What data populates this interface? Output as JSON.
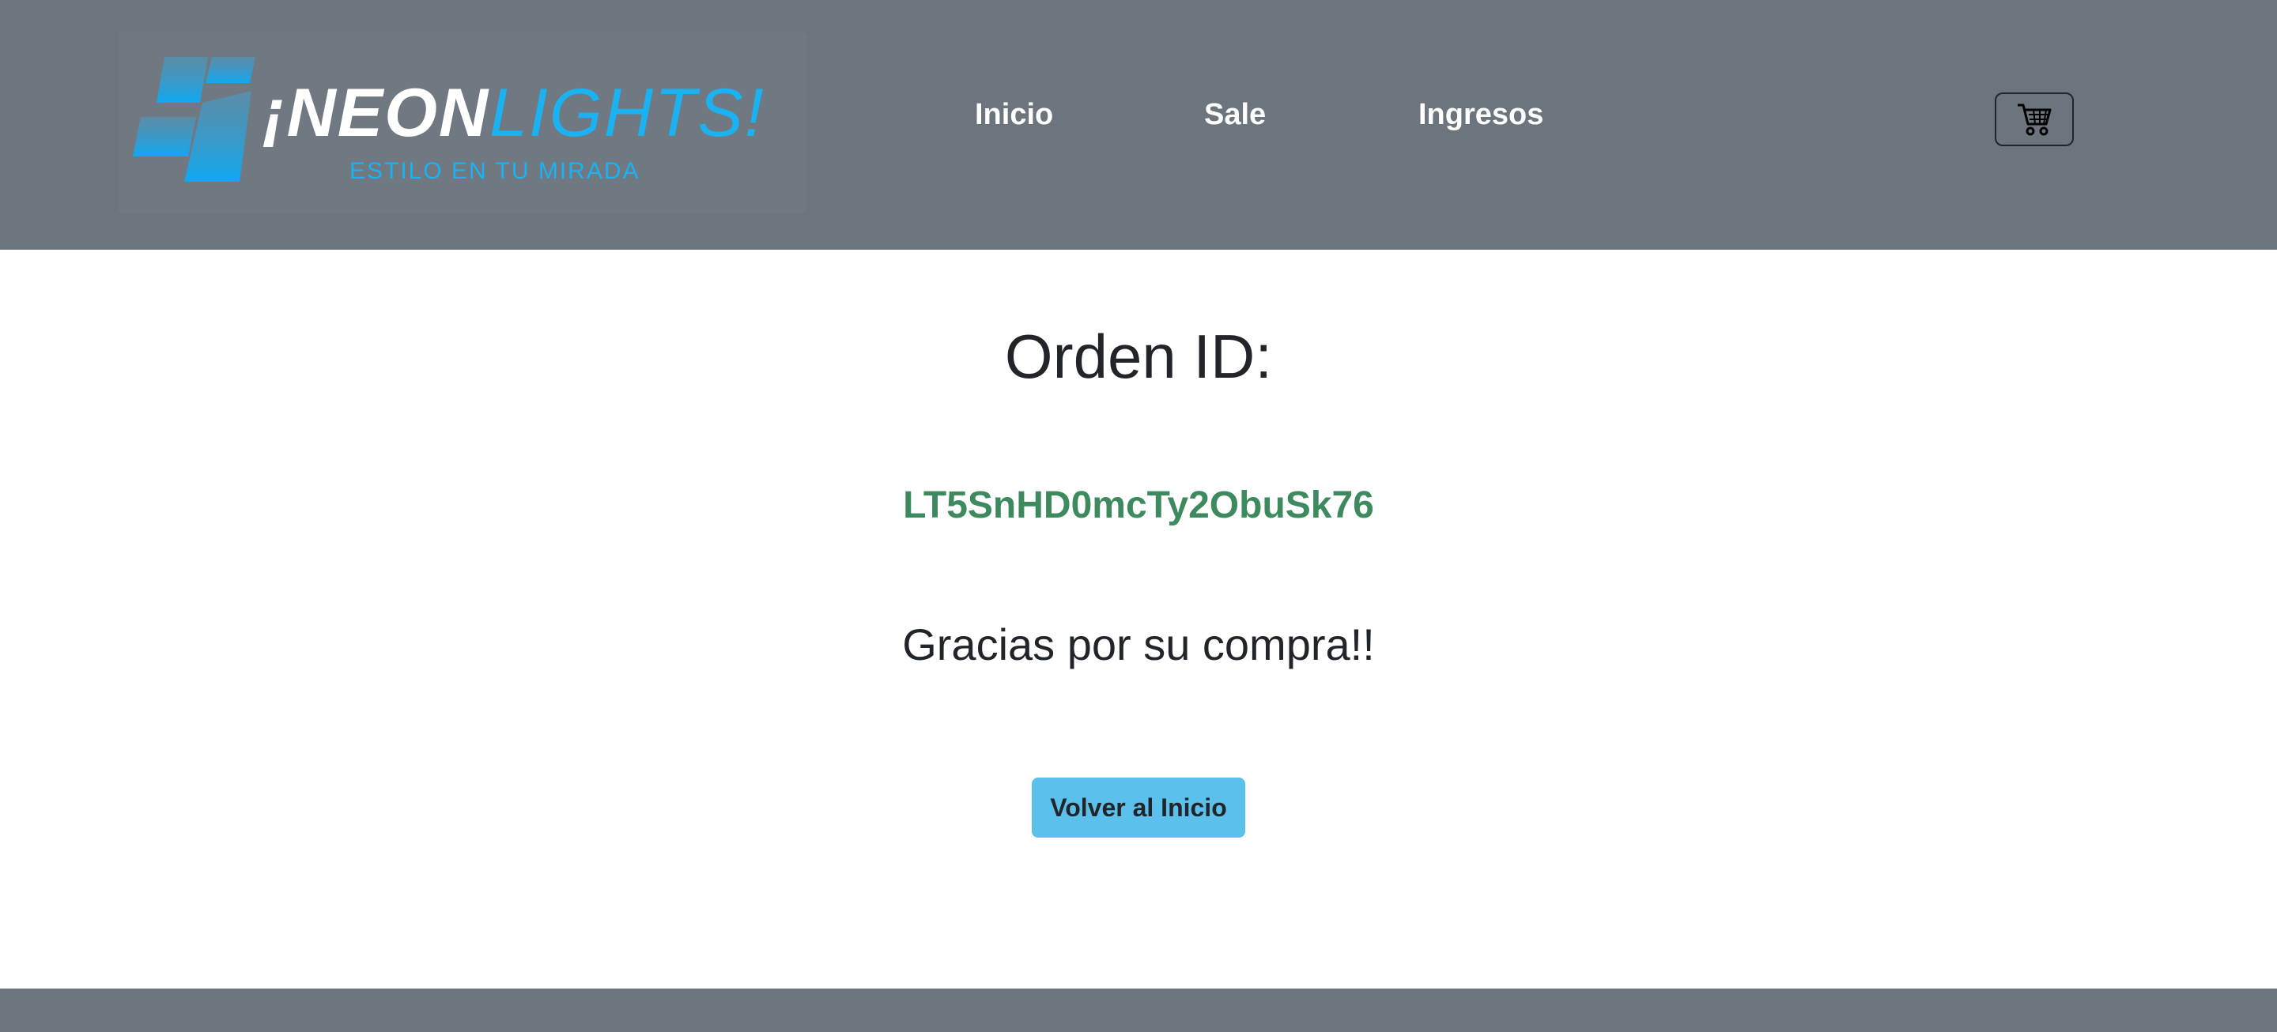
{
  "navbar": {
    "logo": {
      "word_white": "¡NEON",
      "word_blue": "LIGHTS!",
      "tagline": "ESTILO EN TU MIRADA"
    },
    "links": [
      "Inicio",
      "Sale",
      "Ingresos"
    ],
    "cart_icon": "cart-icon"
  },
  "main": {
    "title": "Orden ID:",
    "order_id": "LT5SnHD0mcTy2ObuSk76",
    "thanks": "Gracias por su compra!!",
    "back_button": "Volver al Inicio"
  },
  "colors": {
    "navbar_bg": "#6c757d",
    "brand_blue": "#1ab2f0",
    "order_id_green": "#3d8a5f",
    "button_info": "#5bc0eb"
  }
}
